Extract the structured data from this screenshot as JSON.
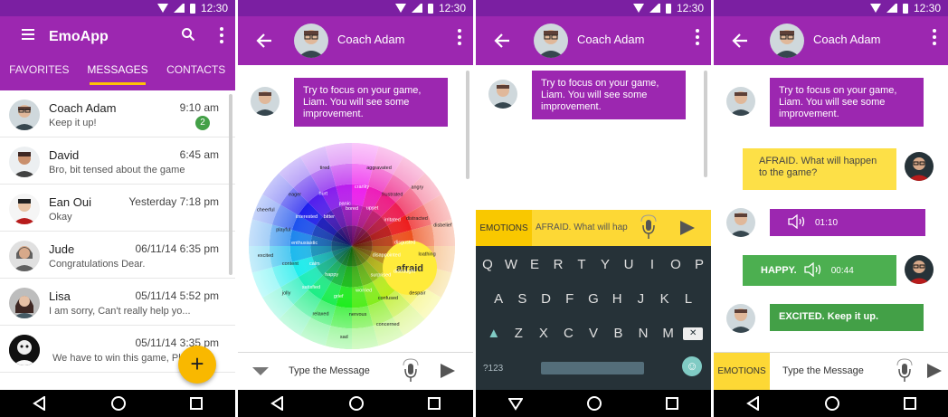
{
  "status": {
    "time": "12:30"
  },
  "screen1": {
    "app_title": "EmoApp",
    "tabs": [
      "FAVORITES",
      "MESSAGES",
      "CONTACTS"
    ],
    "conversations": [
      {
        "name": "Coach Adam",
        "time": "9:10 am",
        "preview": "Keep it up!",
        "badge": "2"
      },
      {
        "name": "David",
        "time": "6:45 am",
        "preview": "Bro, bit tensed about the game"
      },
      {
        "name": "Ean Oui",
        "time": "Yesterday 7:18 pm",
        "preview": "Okay"
      },
      {
        "name": "Jude",
        "time": "06/11/14   6:35 pm",
        "preview": "Congratulations Dear."
      },
      {
        "name": "Lisa",
        "time": "05/11/14   5:52 pm",
        "preview": "I am sorry, Can't really help yo..."
      },
      {
        "name": "",
        "time": "05/11/14   3:35 pm",
        "preview": "We have to win this game, Pla..."
      }
    ],
    "fab_label": "+"
  },
  "coach_name": "Coach Adam",
  "coach_message": "Try to focus on your game, Liam. You will see some improvement.",
  "screen2": {
    "wheel_center": "afraid",
    "wheel_words": [
      "bored",
      "cranky",
      "aggravated",
      "upset",
      "frustrated",
      "angry",
      "irritated",
      "distracted",
      "disbelief",
      "disgusted",
      "loathing",
      "disappointed",
      "distraught",
      "despair",
      "surprised",
      "confused",
      "concerned",
      "worried",
      "nervous",
      "sad",
      "grief",
      "relaxed",
      "happy",
      "satisfied",
      "jolly",
      "calm",
      "content",
      "excited",
      "enthusiastic",
      "playful",
      "cheerful",
      "interested",
      "eager",
      "bitter",
      "hurt",
      "tired",
      "panic"
    ],
    "composer_placeholder": "Type the Message"
  },
  "screen3": {
    "emotions_label": "EMOTIONS",
    "input_value": "AFRAID. What will hap",
    "keyboard": {
      "row1": [
        "Q",
        "W",
        "E",
        "R",
        "T",
        "Y",
        "U",
        "I",
        "O",
        "P"
      ],
      "row2": [
        "A",
        "S",
        "D",
        "F",
        "G",
        "H",
        "J",
        "K",
        "L"
      ],
      "row3": [
        "Z",
        "X",
        "C",
        "V",
        "B",
        "N",
        "M"
      ],
      "numkey": "?123"
    }
  },
  "screen4": {
    "msg_afraid": "AFRAID. What will happen to the game?",
    "audio1_duration": "01:10",
    "happy_label": "HAPPY.",
    "audio2_duration": "00:44",
    "excited_msg": "EXCITED. Keep it up.",
    "emotions_label": "EMOTIONS",
    "composer_placeholder": "Type the Message"
  },
  "colors": {
    "primary": "#9c27b0",
    "primary_dark": "#7b1fa2",
    "accent": "#f9b800",
    "green": "#4caf50",
    "yellow": "#fde047"
  }
}
